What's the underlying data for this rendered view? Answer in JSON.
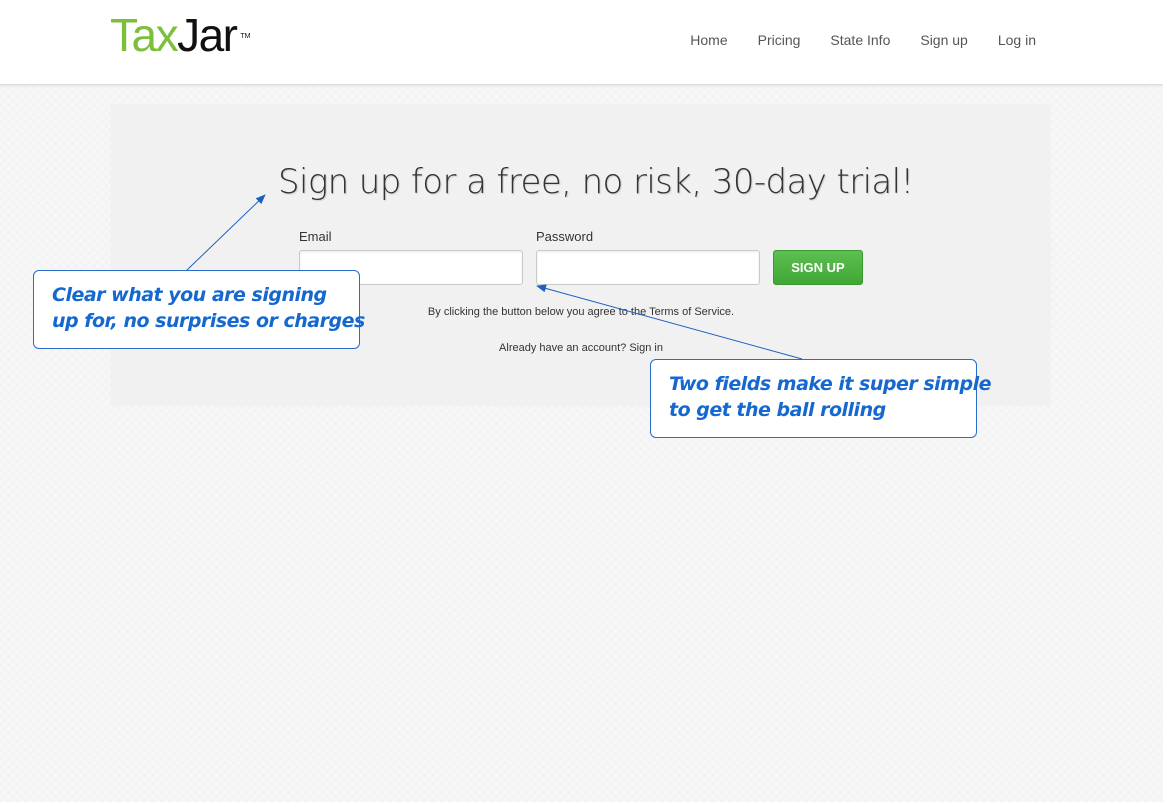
{
  "header": {
    "logo": {
      "part1": "Tax",
      "part2": "Jar",
      "tm": "TM"
    },
    "nav": [
      "Home",
      "Pricing",
      "State Info",
      "Sign up",
      "Log in"
    ]
  },
  "signup": {
    "headline": "Sign up for a free, no risk, 30-day trial!",
    "email_label": "Email",
    "email_value": "",
    "password_label": "Password",
    "password_value": "",
    "button_label": "SIGN UP",
    "terms_prefix": "By clicking the button below you agree to the ",
    "terms_link": "Terms of Service",
    "terms_suffix": ".",
    "already_text": "Already have an account? ",
    "sign_in_link": "Sign in"
  },
  "annotations": {
    "callout1": [
      "Clear what you are signing",
      "up for, no surprises or charges"
    ],
    "callout2": [
      "Two fields make it super simple",
      "to get the ball rolling"
    ],
    "color": "#1468cf"
  },
  "colors": {
    "brand_green": "#7bbf3a",
    "button_green": "#4cb142",
    "panel": "#f1f1f1"
  }
}
